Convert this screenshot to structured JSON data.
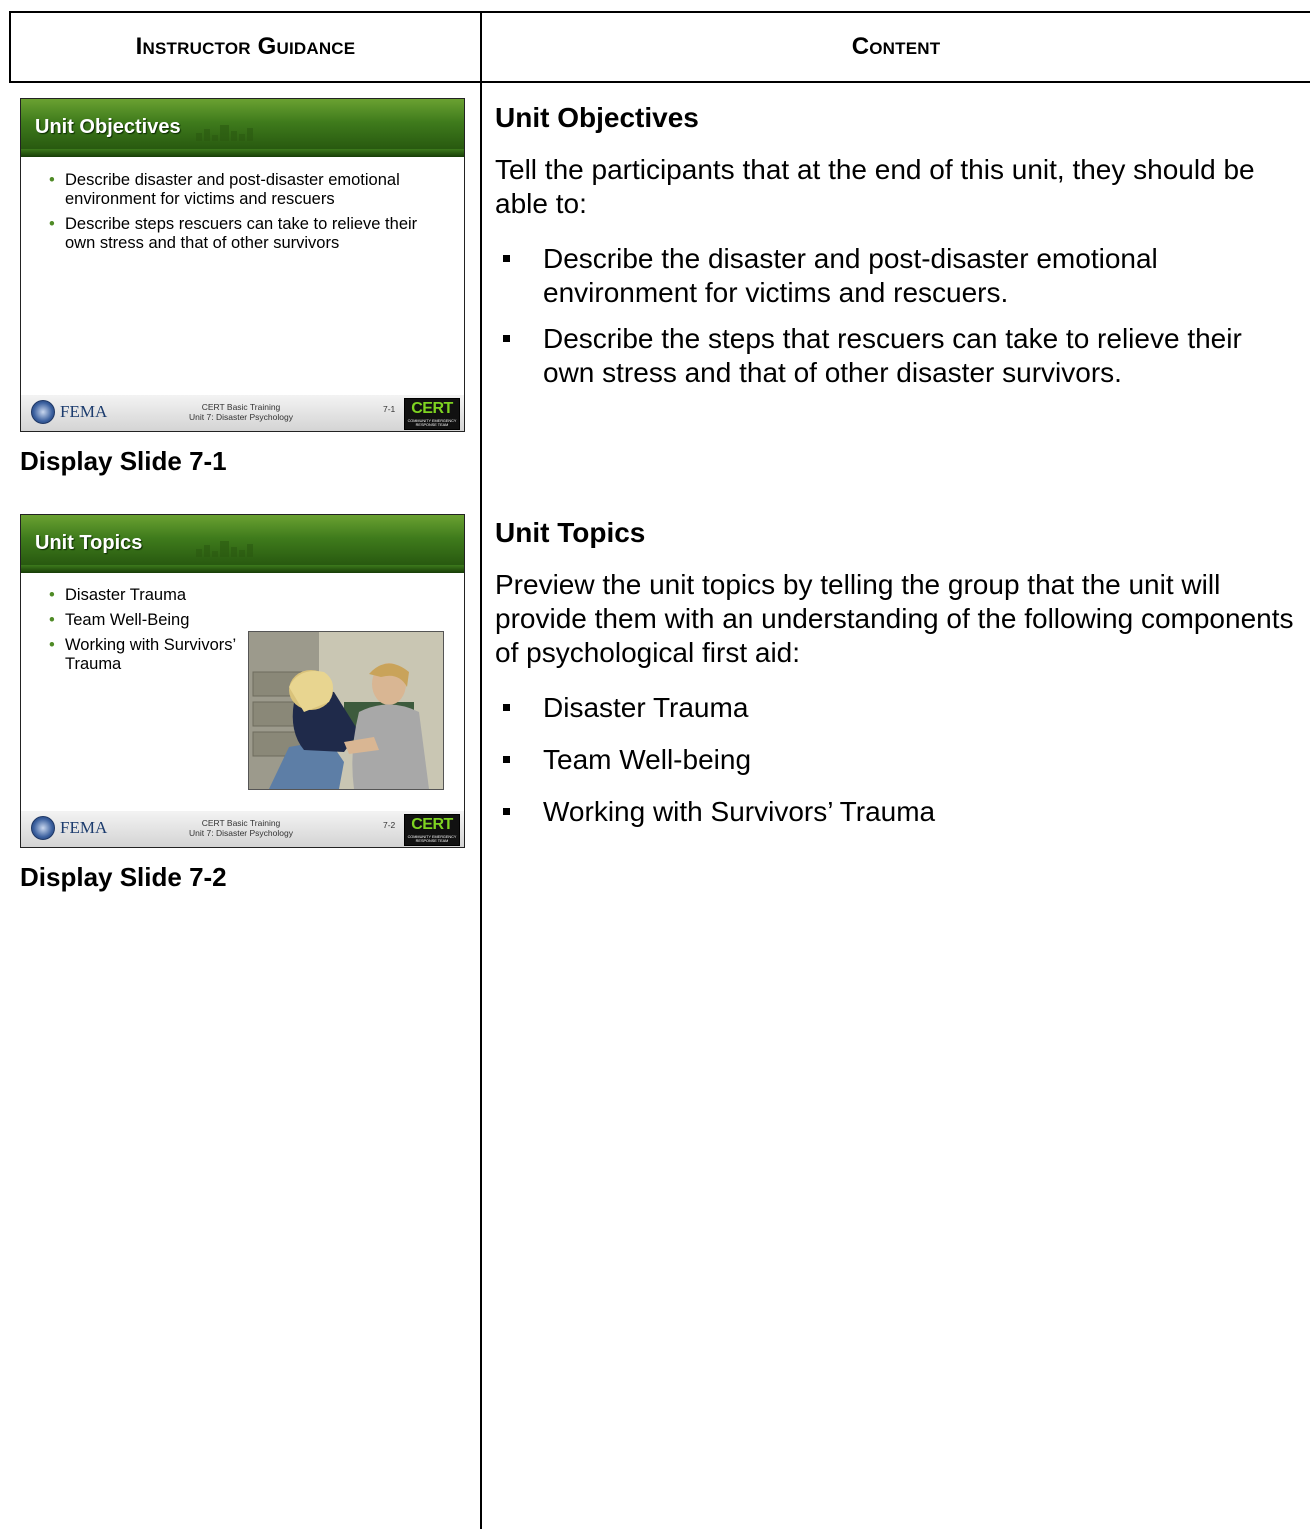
{
  "table": {
    "col_left_header": "Instructor Guidance",
    "col_right_header": "Content"
  },
  "slides": [
    {
      "title": "Unit Objectives",
      "bullets": [
        "Describe disaster and post-disaster emotional environment for victims and rescuers",
        "Describe steps rescuers can take to relieve their own stress and that of other survivors"
      ],
      "footer_agency": "FEMA",
      "footer_line1": "CERT Basic Training",
      "footer_line2": "Unit 7: Disaster Psychology",
      "number": "7-1",
      "logo_text": "CERT",
      "logo_subtext": "COMMUNITY EMERGENCY RESPONSE TEAM",
      "caption": "Display Slide 7-1"
    },
    {
      "title": "Unit Topics",
      "bullets": [
        "Disaster Trauma",
        "Team Well-Being",
        "Working with Survivors’ Trauma"
      ],
      "footer_agency": "FEMA",
      "footer_line1": "CERT Basic Training",
      "footer_line2": "Unit 7: Disaster Psychology",
      "number": "7-2",
      "logo_text": "CERT",
      "logo_subtext": "COMMUNITY EMERGENCY RESPONSE TEAM",
      "caption": "Display Slide 7-2"
    }
  ],
  "content": {
    "sections": [
      {
        "heading": "Unit Objectives",
        "intro": "Tell the participants that at the end of this unit, they should be able to:",
        "items": [
          "Describe the disaster and post-disaster emotional environment for victims and rescuers.",
          "Describe the steps that rescuers can take to relieve their own stress and that of other disaster survivors."
        ]
      },
      {
        "heading": "Unit Topics",
        "intro": "Preview the unit topics by telling the group that the unit will provide them with an understanding of the following components of psychological first aid:",
        "items": [
          "Disaster Trauma",
          "Team Well-being",
          "Working with Survivors’ Trauma"
        ]
      }
    ]
  },
  "colors": {
    "slide_header_green": "#3f7b1c",
    "bullet_green": "#4f8a26",
    "cert_green": "#7ed321",
    "fema_blue": "#1c3c6e"
  }
}
